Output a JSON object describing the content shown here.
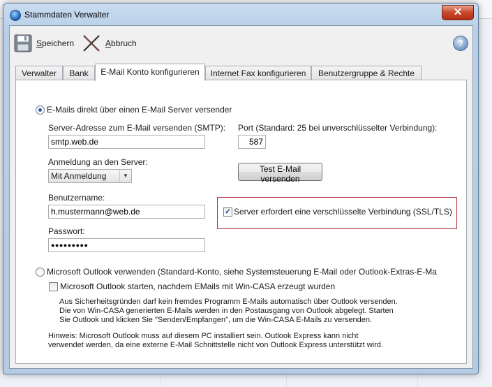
{
  "window": {
    "title": "Stammdaten Verwalter",
    "close_label": "✕"
  },
  "toolbar": {
    "save_prefix": "S",
    "save_rest": "peichern",
    "cancel_prefix": "A",
    "cancel_rest": "bbruch",
    "help_label": "?"
  },
  "tabs": [
    {
      "label": "Verwalter"
    },
    {
      "label": "Bank"
    },
    {
      "label": "E-Mail Konto konfigurieren"
    },
    {
      "label": "Internet Fax konfigurieren"
    },
    {
      "label": "Benutzergruppe & Rechte"
    }
  ],
  "active_tab": "E-Mail Konto konfigurieren",
  "email": {
    "direct_label": "E-Mails direkt über einen E-Mail Server versender",
    "smtp_label": "Server-Adresse zum E-Mail versenden (SMTP):",
    "smtp_value": "smtp.web.de",
    "port_label": "Port (Standard: 25 bei unverschlüsselter Verbindung):",
    "port_value": "587",
    "login_label": "Anmeldung an den Server:",
    "login_value": "Mit Anmeldung",
    "test_button": "Test E-Mail versenden",
    "username_label": "Benutzername:",
    "username_value": "h.mustermann@web.de",
    "password_label": "Passwort:",
    "password_value": "●●●●●●●●●",
    "ssl_label": "Server erfordert eine verschlüsselte Verbindung (SSL/TLS)",
    "ssl_checked": true
  },
  "outlook": {
    "radio_label": "Microsoft Outlook verwenden  (Standard-Konto, siehe Systemsteuerung E-Mail oder Outlook-Extras-E-Ma",
    "start_label": "Microsoft Outlook starten, nachdem EMails mit Win-CASA erzeugt wurden",
    "info_line1": "Aus Sicherheitsgründen darf kein fremdes Programm E-Mails automatisch über Outlook versenden.",
    "info_line2": "Die von Win-CASA generierten E-Mails werden in den Postausgang von Outlook abgelegt. Starten",
    "info_line3": "Sie Outlook und klicken Sie \"Senden/Empfangen\", um die Win-CASA E-Mails zu versenden.",
    "hint_line1": "Hinweis: Microsoft Outlook muss auf diesem PC installiert sein. Outlook Express kann nicht",
    "hint_line2": "verwendet werden, da eine externe E-Mail Schnittstelle nicht von Outlook Express unterstützt wird."
  },
  "colors": {
    "ssl_highlight": "#b0303c",
    "accent": "#2a5ea8"
  }
}
